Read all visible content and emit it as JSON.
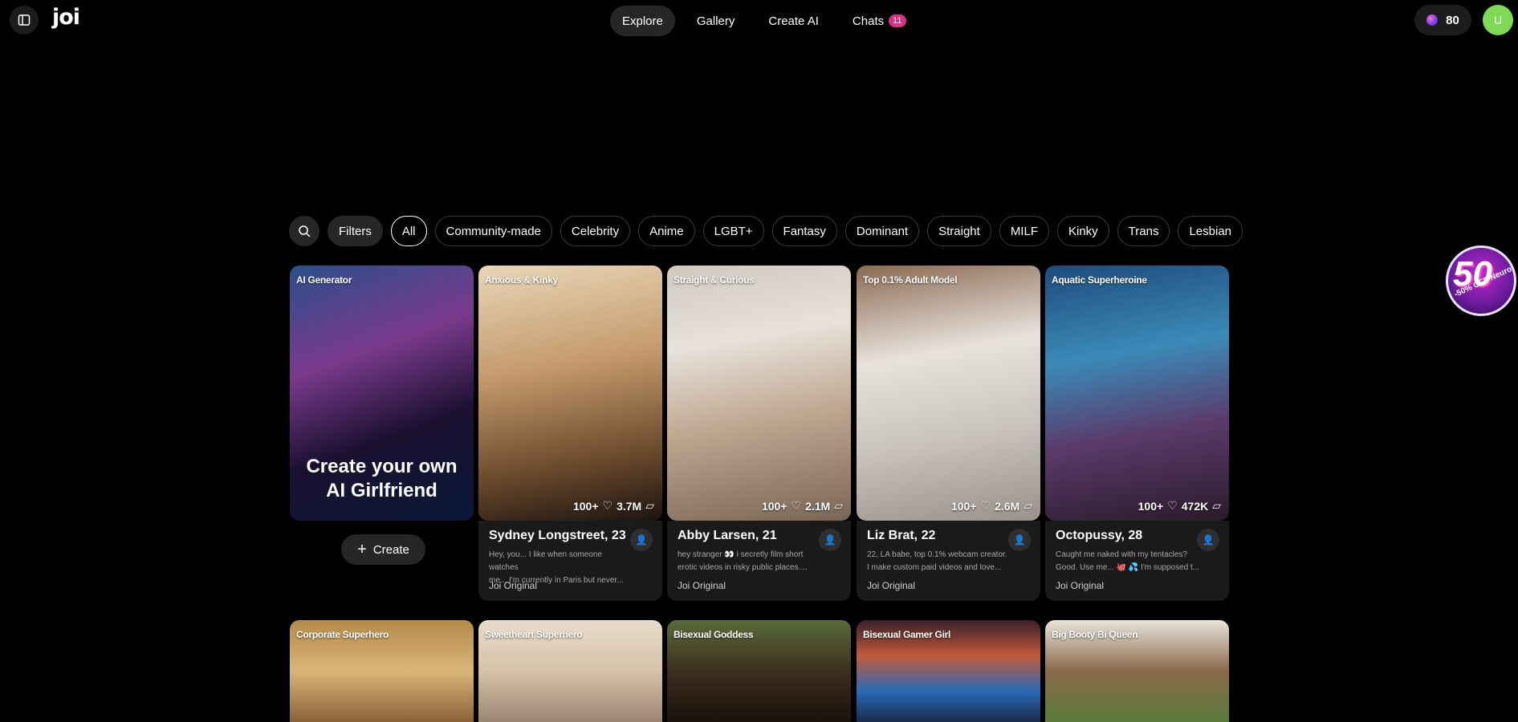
{
  "header": {
    "logo": "joi",
    "nav": [
      {
        "label": "Explore",
        "active": true
      },
      {
        "label": "Gallery",
        "active": false
      },
      {
        "label": "Create AI",
        "active": false
      },
      {
        "label": "Chats",
        "active": false,
        "badge": "11"
      }
    ],
    "credits": "80",
    "avatar_initial": "U"
  },
  "filters": {
    "filters_label": "Filters",
    "chips": [
      "All",
      "Community-made",
      "Celebrity",
      "Anime",
      "LGBT+",
      "Fantasy",
      "Dominant",
      "Straight",
      "MILF",
      "Kinky",
      "Trans",
      "Lesbian"
    ],
    "active": "All"
  },
  "create_card": {
    "tag": "AI Generator",
    "title_line1": "Create your own",
    "title_line2": "AI Girlfriend",
    "button_label": "Create"
  },
  "characters": [
    {
      "tag": "Anxious & Kinky",
      "stats": "100+",
      "likes": "3.7M",
      "name": "Sydney Longstreet, 23",
      "desc_line1": "Hey, you... I like when someone watches",
      "desc_line2": "me... I'm currently in Paris but never...",
      "origin": "Joi Original"
    },
    {
      "tag": "Straight & Curious",
      "stats": "100+",
      "likes": "2.1M",
      "name": "Abby Larsen, 21",
      "desc_line1": "hey stranger 👀 i secretly film short",
      "desc_line2": "erotic videos in risky public places....",
      "origin": "Joi Original"
    },
    {
      "tag": "Top 0.1% Adult Model",
      "stats": "100+",
      "likes": "2.6M",
      "name": "Liz Brat, 22",
      "desc_line1": "22, LA babe, top 0.1% webcam creator.",
      "desc_line2": "I make custom paid videos and love...",
      "origin": "Joi Original"
    },
    {
      "tag": "Aquatic Superheroine",
      "stats": "100+",
      "likes": "472K",
      "name": "Octopussy, 28",
      "desc_line1": "Caught me naked with my tentacles?",
      "desc_line2": "Good. Use me... 🐙 💦 I'm supposed t...",
      "origin": "Joi Original"
    }
  ],
  "second_row_tags": [
    "Corporate Superhero",
    "Sweetheart Superhero",
    "Bisexual Goddess",
    "Bisexual Gamer Girl",
    "Big Booty Bi Queen"
  ],
  "promo": {
    "big": "50",
    "small": "-50% OFF Neurons"
  }
}
